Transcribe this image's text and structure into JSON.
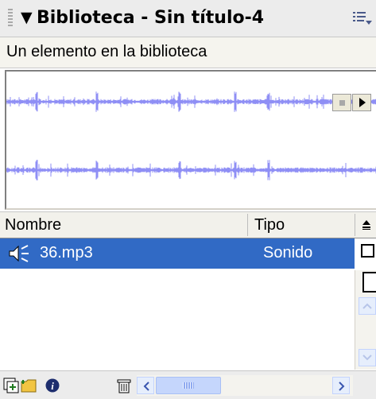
{
  "panel": {
    "title": "Biblioteca - Sin título-4",
    "status": "Un elemento en la biblioteca"
  },
  "colors": {
    "selection": "#316ac5",
    "waveform": "#8f8ff5",
    "panel_bg": "#ececec"
  },
  "icons": {
    "collapse": "triangle-down-icon",
    "options": "panel-options-icon",
    "stop": "stop-icon",
    "play": "play-icon",
    "sort": "sort-order-icon",
    "item": "sound-icon",
    "new_symbol": "new-symbol-icon",
    "new_folder": "new-folder-icon",
    "properties": "properties-icon",
    "delete": "trash-icon"
  },
  "columns": {
    "name": "Nombre",
    "type": "Tipo"
  },
  "items": [
    {
      "name": "36.mp3",
      "type": "Sonido",
      "selected": true
    }
  ]
}
